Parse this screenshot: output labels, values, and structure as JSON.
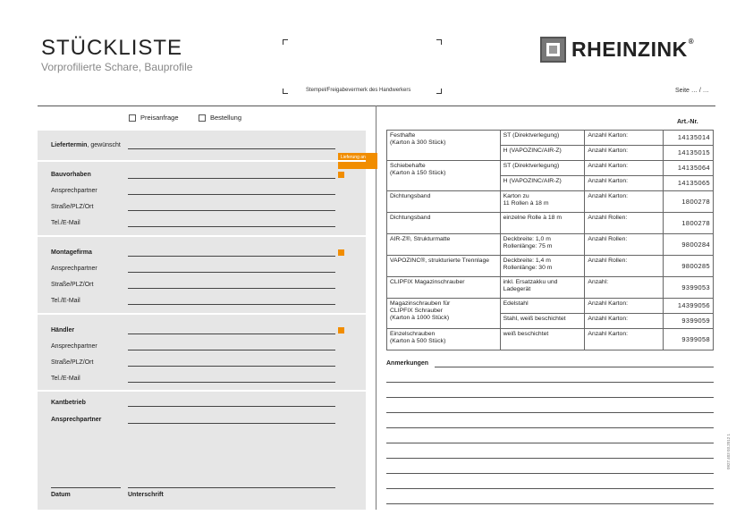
{
  "header": {
    "title": "STÜCKLISTE",
    "subtitle": "Vorprofilierte Schare, Bauprofile",
    "stamp_label": "Stempel/Freigabevermerk des Handwerkers",
    "brand": "RHEINZINK",
    "brand_reg": "®",
    "page_label": "Seite  … / …"
  },
  "order_type": {
    "price_request": "Preisanfrage",
    "order": "Bestellung"
  },
  "form": {
    "delivery_date": "Liefertermin",
    "delivery_date_suffix": ", gewünscht",
    "delivery_badge": "Lieferung an",
    "project": "Bauvorhaben",
    "contact1": "Ansprechpartner",
    "street1": "Straße/PLZ/Ort",
    "phone1": "Tel./E-Mail",
    "installer": "Montagefirma",
    "contact2": "Ansprechpartner",
    "street2": "Straße/PLZ/Ort",
    "phone2": "Tel./E-Mail",
    "dealer": "Händler",
    "contact3": "Ansprechpartner",
    "street3": "Straße/PLZ/Ort",
    "phone3": "Tel./E-Mail",
    "edging": "Kantbetrieb",
    "contact4": "Ansprechpartner",
    "date": "Datum",
    "signature": "Unterschrift"
  },
  "table": {
    "art_nr_header": "Art.-Nr.",
    "rows": [
      {
        "product": "Festhafte",
        "pack": "(Karton à 300 Stück)",
        "opt1": "ST (Direktverlegung)",
        "opt2": "H  (VAPOZINC/AIR-Z)",
        "qty1": "Anzahl Karton:",
        "qty2": "Anzahl Karton:",
        "art1": "14135014",
        "art2": "14135015"
      },
      {
        "product": "Schiebehafte",
        "pack": "(Karton à 150 Stück)",
        "opt1": "ST (Direktverlegung)",
        "opt2": "H  (VAPOZINC/AIR-Z)",
        "qty1": "Anzahl Karton:",
        "qty2": "Anzahl Karton:",
        "art1": "14135064",
        "art2": "14135065"
      },
      {
        "product": "Dichtungsband",
        "opt": "Karton zu",
        "opt_b": "11 Rollen à 18 m",
        "qty": "Anzahl Karton:",
        "art": "1800278"
      },
      {
        "product": "Dichtungsband",
        "opt": "einzelne Rolle à 18 m",
        "qty": "Anzahl Rollen:",
        "art": "1800278"
      },
      {
        "product": "AIR-Z®, Strukturmatte",
        "opt": "Deckbreite: 1,0 m",
        "opt_b": "Rollenlänge: 75 m",
        "qty": "Anzahl Rollen:",
        "art": "9800284"
      },
      {
        "product": "VAPOZINC®, strukturierte Trennlage",
        "opt": "Deckbreite: 1,4 m",
        "opt_b": "Rollenlänge: 30 m",
        "qty": "Anzahl Rollen:",
        "art": "9800285"
      },
      {
        "product": "CLIPFIX Magazinschrauber",
        "opt": "inkl. Ersatzakku und",
        "opt_b": "Ladegerät",
        "qty": "Anzahl:",
        "art": "9399053"
      },
      {
        "product": "Magazinschrauben für",
        "product_b": "CLIPFIX Schrauber",
        "product_c": "(Karton à 1000 Stück)",
        "opt1": "Edelstahl",
        "opt2": "Stahl, weiß beschichtet",
        "qty1": "Anzahl Karton:",
        "qty2": "Anzahl Karton:",
        "art1": "14399056",
        "art2": "9399059"
      },
      {
        "product": "Einzelschrauben",
        "pack": "(Karton à 500 Stück)",
        "opt": "weiß beschichtet",
        "qty": "Anzahl Karton:",
        "art": "9399058"
      }
    ]
  },
  "notes_label": "Anmerkungen",
  "doc_code": "0927.403 03.2012 1"
}
